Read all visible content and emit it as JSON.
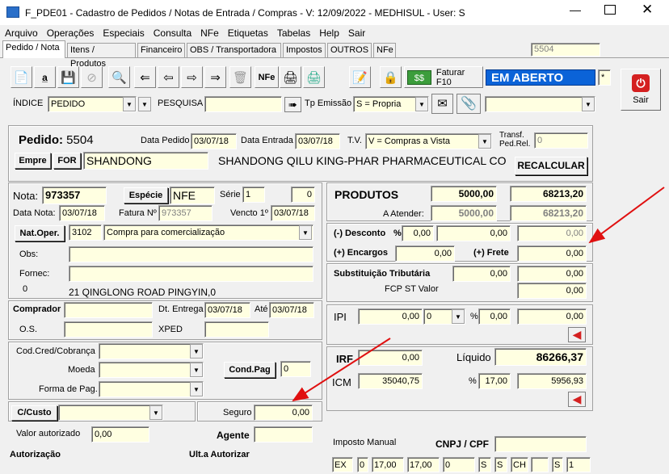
{
  "window": {
    "title": "F_PDE01 - Cadastro de Pedidos / Notas de Entrada / Compras - V: 12/09/2022 - MEDHISUL - User: S"
  },
  "menu": [
    "Arquivo",
    "Operações",
    "Especiais",
    "Consulta",
    "NFe",
    "Etiquetas",
    "Tabelas",
    "Help",
    "Sair"
  ],
  "tabs": [
    "Pedido / Nota",
    "Itens / Produtos",
    "Financeiro",
    "OBS / Transportadora",
    "Impostos",
    "OUTROS",
    "NFe"
  ],
  "top_code": "5504",
  "toolbar": {
    "nfe_label": "NFe",
    "faturar_label": "Faturar F10",
    "status": "EM ABERTO",
    "star": "*",
    "sair_label": "Sair"
  },
  "search": {
    "indice_label": "ÍNDICE",
    "indice_value": "PEDIDO",
    "pesquisa_label": "PESQUISA",
    "pesquisa_value": "",
    "tp_emissao_label": "Tp Emissão",
    "tp_emissao_value": "S = Propria",
    "right_combo": ""
  },
  "pedido": {
    "label": "Pedido:",
    "number": "5504",
    "data_pedido_label": "Data Pedido",
    "data_pedido": "03/07/18",
    "data_entrada_label": "Data Entrada",
    "data_entrada": "03/07/18",
    "tv_label": "T.V.",
    "tv_value": "V = Compras a Vista",
    "transf_label": "Transf.\nPed.Rel.",
    "transf_value": "0",
    "empre_label": "Empre",
    "for_label": "FOR",
    "for_code": "SHANDONG",
    "supplier_name": "SHANDONG QILU KING-PHAR PHARMACEUTICAL CO",
    "recalcular_label": "RECALCULAR"
  },
  "nota": {
    "nota_label": "Nota:",
    "nota": "973357",
    "especie_label": "Espécie",
    "especie": "NFE",
    "serie_label": "Série",
    "serie": "1",
    "serie2": "0",
    "data_nota_label": "Data Nota:",
    "data_nota": "03/07/18",
    "fatura_label": "Fatura Nº",
    "fatura": "973357",
    "vencto_label": "Vencto 1º",
    "vencto": "03/07/18",
    "natoper_label": "Nat.Oper.",
    "natoper_code": "3102",
    "natoper_desc": "Compra para comercialização",
    "obs_label": "Obs:",
    "obs": "",
    "fornec_label": "Fornec:",
    "fornec": "",
    "fornec_num": "0",
    "address": "21 QINGLONG ROAD PINGYIN,0",
    "comprador_label": "Comprador",
    "comprador": "",
    "dt_entrega_label": "Dt. Entrega",
    "dt_entrega": "03/07/18",
    "ate_label": "Até",
    "ate": "03/07/18",
    "os_label": "O.S.",
    "os": "",
    "xped_label": "XPED",
    "xped": "",
    "codcred_label": "Cod.Cred/Cobrança",
    "codcred": "",
    "moeda_label": "Moeda",
    "moeda": "",
    "condpag_label": "Cond.Pag",
    "condpag": "0",
    "formapag_label": "Forma de Pag.",
    "formapag": "",
    "ccusto_label": "C/Custo",
    "ccusto": "",
    "seguro_label": "Seguro",
    "seguro": "0,00",
    "valor_aut_label": "Valor autorizado",
    "valor_aut": "0,00",
    "agente_label": "Agente",
    "agente": "",
    "autorizacao_label": "Autorização",
    "ult_autorizar_label": "Ult.a Autorizar"
  },
  "totais": {
    "produtos_label": "PRODUTOS",
    "produtos_qtd": "5000,00",
    "produtos_valor": "68213,20",
    "a_atender_label": "A Atender:",
    "a_atender_qtd": "5000,00",
    "a_atender_valor": "68213,20",
    "desconto_label": "(-) Desconto",
    "pct": "%",
    "desconto_pct": "0,00",
    "desconto_val": "0,00",
    "desconto_total": "0,00",
    "encargos_label": "(+) Encargos",
    "encargos": "0,00",
    "frete_label": "(+) Frete",
    "frete": "0,00",
    "subst_label": "Substituição Tributária",
    "subst_base": "0,00",
    "subst_val": "0,00",
    "fcp_label": "FCP ST Valor",
    "fcp": "0,00",
    "ipi_label": "IPI",
    "ipi_base": "0,00",
    "ipi_combo": "0",
    "ipi_pct": "0,00",
    "ipi_val": "0,00",
    "irf_label": "IRF",
    "irf": "0,00",
    "liquido_label": "Líquido",
    "liquido": "86266,37",
    "icm_label": "ICM",
    "icm_base": "35040,75",
    "icm_pct": "17,00",
    "icm_val": "5956,93",
    "imposto_manual_label": "Imposto Manual",
    "cnpj_label": "CNPJ / CPF",
    "cnpj": "",
    "bottom": [
      "EX",
      "0",
      "17,00",
      "17,00",
      "0",
      "S",
      "S",
      "CH",
      "",
      "S",
      "1"
    ]
  }
}
